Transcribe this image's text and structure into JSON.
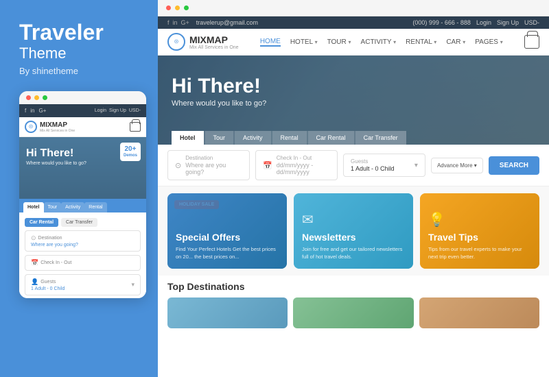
{
  "left_panel": {
    "title": "Traveler",
    "subtitle": "Theme",
    "by": "By shinetheme"
  },
  "mobile": {
    "dots": [
      "red",
      "yellow",
      "green"
    ],
    "nav_links": [
      "f",
      "in",
      "G+"
    ],
    "nav_actions": [
      "Login",
      "Sign Up",
      "USD-"
    ],
    "logo_main": "MIXMAP",
    "logo_sub": "Mix All Services in One",
    "hero_title": "Hi There!",
    "hero_sub": "Where would you like to go?",
    "demos_num": "20+",
    "demos_label": "Demos",
    "tabs": [
      "Hotel",
      "Tour",
      "Activity",
      "Rental"
    ],
    "tabs2": [
      "Car Rental",
      "Car Transfer"
    ],
    "search_fields": [
      {
        "label": "Destination",
        "value": "Where are you going?"
      },
      {
        "label": "Check In - Out",
        "value": ""
      },
      {
        "label": "Guests",
        "value": "1 Adult - 0 Child"
      }
    ]
  },
  "site": {
    "topbar_left": {
      "social": [
        "f",
        "in",
        "G+"
      ],
      "email": "travelerup@gmail.com"
    },
    "topbar_right": {
      "phone": "(000) 999 - 666 - 888",
      "login": "Login",
      "signup": "Sign Up",
      "currency": "USD-"
    },
    "nav": {
      "logo_main": "MIXMAP",
      "logo_sub": "Mix All Services in One",
      "links": [
        "HOME",
        "HOTEL",
        "TOUR",
        "ACTIVITY",
        "RENTAL",
        "CAR",
        "PAGES"
      ]
    },
    "hero": {
      "title": "Hi There!",
      "subtitle": "Where would you like to go?",
      "tabs": [
        "Hotel",
        "Tour",
        "Activity",
        "Rental",
        "Car Rental",
        "Car Transfer"
      ]
    },
    "search_bar": {
      "destination_label": "Destination",
      "destination_placeholder": "Where are you going?",
      "checkin_label": "Check In - Out",
      "checkin_placeholder": "dd/mm/yyyy - dd/mm/yyyy",
      "guests_label": "Guests",
      "guests_value": "1 Adult - 0 Child",
      "advance_label": "Advance More ▾",
      "search_btn": "SEARCH"
    },
    "cards": [
      {
        "badge": "HOLIDAY SALE",
        "title": "Special Offers",
        "desc": "Find Your Perfect Hotels Get the best prices on 20... the best prices on..."
      },
      {
        "title": "Newsletters",
        "desc": "Join for free and get our tailored newsletters full of hot travel deals."
      },
      {
        "title": "Travel Tips",
        "desc": "Tips from our travel experts to make your next trip even better."
      }
    ],
    "bottom": {
      "section_title": "Top Destinations"
    }
  }
}
